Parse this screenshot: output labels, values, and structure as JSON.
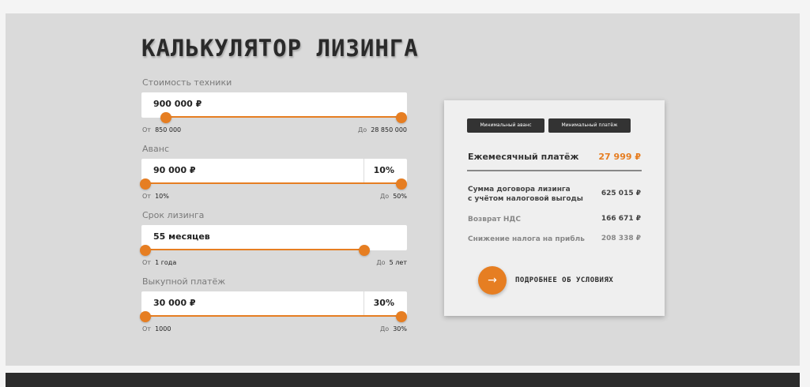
{
  "title": "КАЛЬКУЛЯТОР ЛИЗИНГА",
  "fields": {
    "cost": {
      "label": "Стоимость техники",
      "value": "900 000 ₽",
      "from_label": "От",
      "from": "850 000",
      "to_label": "До",
      "to": "28 850 000"
    },
    "advance": {
      "label": "Аванс",
      "value": "90 000 ₽",
      "percent": "10%",
      "from_label": "От",
      "from": "10%",
      "to_label": "До",
      "to": "50%"
    },
    "term": {
      "label": "Срок лизинга",
      "value": "55 месяцев",
      "from_label": "От",
      "from": "1 года",
      "to_label": "До",
      "to": "5 лет"
    },
    "buyout": {
      "label": "Выкупной платёж",
      "value": "30 000 ₽",
      "percent": "30%",
      "from_label": "От",
      "from": "1000",
      "to_label": "До",
      "to": "30%"
    }
  },
  "summary": {
    "chips": [
      "Минимальный аванс",
      "Минимальный платёж"
    ],
    "monthly_label": "Ежемесячный платёж",
    "monthly_value": "27 999 ₽",
    "contract_label_line1": "Сумма договора лизинга",
    "contract_label_line2": "с учётом налоговой выгоды",
    "contract_value": "625 015 ₽",
    "vat_label": "Возврат НДС",
    "vat_value": "166 671 ₽",
    "tax_label": "Снижение налога на прибль",
    "tax_value": "208 338 ₽",
    "more_label": "ПОДРОБНЕЕ ОБ УСЛОВИЯХ",
    "more_icon": "arrow-right-icon"
  },
  "colors": {
    "accent": "#e67e22",
    "panel": "#dadada",
    "footer": "#2c2c2c"
  }
}
